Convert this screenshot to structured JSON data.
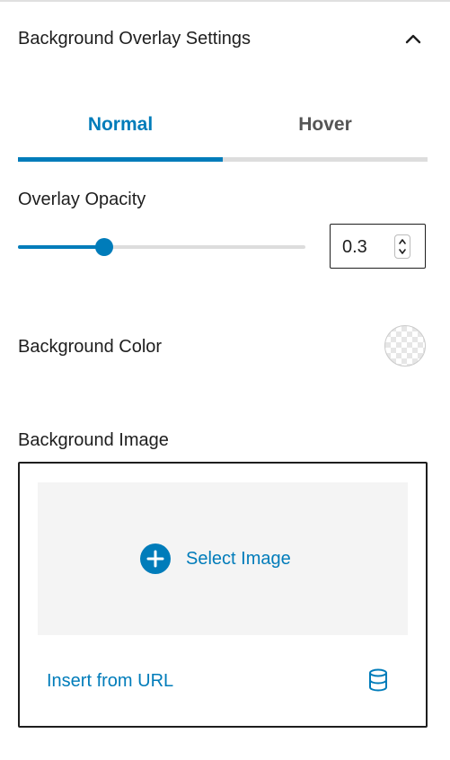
{
  "panel": {
    "title": "Background Overlay Settings",
    "collapse_icon": "chevron-up-icon"
  },
  "tabs": [
    {
      "label": "Normal",
      "active": true
    },
    {
      "label": "Hover",
      "active": false
    }
  ],
  "overlay_opacity": {
    "label": "Overlay Opacity",
    "value": "0.3",
    "slider_fraction": 0.3,
    "spinner_icon": "up-down-stepper-icon"
  },
  "background_color": {
    "label": "Background Color",
    "swatch_icon": "transparent-color-swatch"
  },
  "background_image": {
    "label": "Background Image",
    "select_label": "Select Image",
    "select_icon": "plus-circle-icon",
    "insert_url_label": "Insert from URL",
    "media_library_icon": "database-icon"
  },
  "colors": {
    "accent": "#007cba",
    "text": "#1e1e1e",
    "muted_tab": "#555555",
    "track": "#dddddd",
    "dropzone_bg": "#f4f4f4"
  }
}
